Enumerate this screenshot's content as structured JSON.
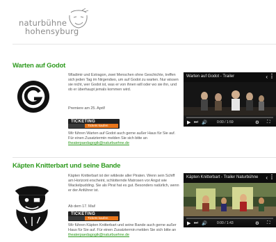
{
  "header": {
    "logo_line1": "naturbühne",
    "logo_line2": "hohensyburg"
  },
  "shows": [
    {
      "title": "Warten auf Godot",
      "description": "Wladimir und Estragon, zwei Menschen ohne Geschichte, treffen sich jeden Tag im Nirgendwo, um auf Godot zu warten. Nur wissen sie nicht, wer Godot ist, was er von ihnen will oder wo sie ihn, und ob er überhaupt jemals kommen wird.",
      "premiere": "Premiere am 25. April!",
      "ticket_main": "TICKETING",
      "ticket_sub": "Tickets kaufen",
      "note": "Wir führen Warten auf Godot auch gerne außer Haus für Sie auf. Für einen Zusatztermin melden Sie sich bitte an",
      "note_link": "theaterpaedagogik@naturbuehne.de",
      "video_title": "Warten auf Godot - Trailer",
      "video_time": "0:00 / 1:59"
    },
    {
      "title": "Käpten Knitterbart und seine Bande",
      "description": "Käpten Knitterbart ist der wildeste aller Piraten. Wenn sein Schiff am Horizont erscheint, schlotternde Matrosen vor Angst wie Wackelpudding. Sie als Pirat hat es gut. Besonders natürlich, wenn er der Anführer ist.",
      "premiere": "Ab dem 17. Mai!",
      "ticket_main": "TICKETING",
      "ticket_sub": "Tickets kaufen",
      "note": "Wir führen Käpten Knitterbart und seine Bande auch gerne außer Haus für Sie auf. Für einen Zusatztermin melden Sie sich bitte an",
      "note_link": "theaterpaedagogik@naturbuehne.de",
      "video_title": "Käpten Knitterbart - Trailer Naturbühne",
      "video_time": "0:00 / 1:43"
    }
  ],
  "icons": {
    "share": "share-icon",
    "more": "more-icon",
    "play": "play-icon",
    "skip": "skip-next-icon",
    "volume": "volume-icon",
    "settings": "gear-icon",
    "fullscreen": "fullscreen-icon"
  },
  "colors": {
    "accent_green": "#2e9a1e",
    "ticket_orange": "#e8751a",
    "video_bg": "#0d0d0d"
  }
}
